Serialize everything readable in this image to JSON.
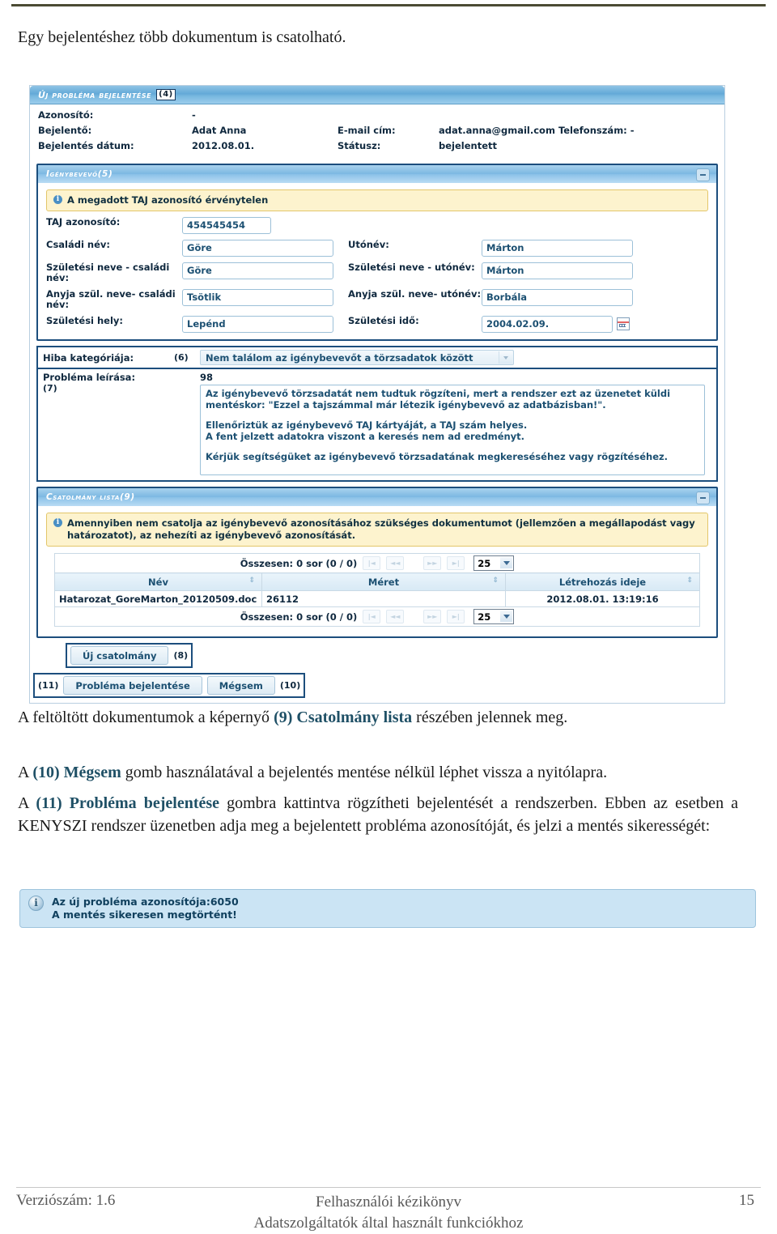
{
  "document": {
    "intro": "Egy bejelentéshez több dokumentum is csatolható.",
    "para_after_1": "A feltöltött dokumentumok a képernyő ",
    "para_after_1_hl": "(9) Csatolmány lista",
    "para_after_1_rest": " részében jelennek meg.",
    "para_after_2_pre": "A ",
    "para_after_2_hl": "(10) Mégsem",
    "para_after_2_rest": " gomb használatával a bejelentés mentése nélkül léphet vissza a nyitólapra.",
    "para_after_3_pre": "A ",
    "para_after_3_hl": "(11) Probléma bejelentése",
    "para_after_3_rest": " gombra kattintva rögzítheti bejelentését a rendszerben. Ebben az esetben a KENYSZI rendszer üzenetben adja meg a bejelentett probléma azonosítóját, és jelzi a mentés sikerességét:"
  },
  "screen": {
    "panel_title": "Új probléma bejelentése",
    "panel_title_tag": "(4)",
    "header_fields": {
      "azonosito_label": "Azonosító:",
      "azonosito_value": "-",
      "bejelento_label": "Bejelentő:",
      "bejelento_value": "Adat Anna",
      "email_label": "E-mail cím:",
      "email_value": "adat.anna@gmail.com Telefonszám:    -",
      "datum_label": "Bejelentés dátum:",
      "datum_value": "2012.08.01.",
      "statusz_label": "Státusz:",
      "statusz_value": "bejelentett"
    },
    "igenybevevo": {
      "section_title": "Igénybevevő",
      "section_tag": "(5)",
      "warning": "A megadott TAJ azonosító érvénytelen",
      "info_icon": "i",
      "fields": [
        {
          "label": "TAJ azonosító:",
          "value": "454545454"
        },
        {
          "label": "Családi név:",
          "value": "Göre"
        },
        {
          "label": "Utónév:",
          "value": "Márton"
        },
        {
          "label": "Születési neve - családi név:",
          "value": "Göre"
        },
        {
          "label": "Születési neve - utónév:",
          "value": "Márton"
        },
        {
          "label": "Anyja szül. neve- családi név:",
          "value": "Tsötlik"
        },
        {
          "label": "Anyja szül. neve- utónév:",
          "value": "Borbála"
        },
        {
          "label": "Születési hely:",
          "value": "Lepénd"
        },
        {
          "label": "Születési idő:",
          "value": "2004.02.09."
        }
      ]
    },
    "category": {
      "label": "Hiba kategóriája:",
      "tag": "(6)",
      "selected": "Nem találom az igénybevevőt a törzsadatok között"
    },
    "description": {
      "label": "Probléma leírása:",
      "tag": "(7)",
      "counter": "98",
      "line1": "Az igénybevevő törzsadatát nem tudtuk rögzíteni, mert a rendszer ezt az üzenetet küldi",
      "line2": "mentéskor: \"Ezzel a tajszámmal már létezik igénybevevő az adatbázisban!\".",
      "line3": "Ellenőriztük az igénybevevő TAJ kártyáját, a TAJ szám helyes.",
      "line4": "A fent jelzett adatokra viszont a keresés nem ad eredményt.",
      "line5": "Kérjük segítségüket az igénybevevő törzsadatának megkereséséhez vagy rögzítéséhez."
    },
    "attachments": {
      "section_title": "Csatolmány lista",
      "section_tag": "(9)",
      "warning_line1": "Amennyiben nem csatolja az igénybevevő azonosításához szükséges dokumentumot (jellemzően a megállapodást",
      "warning_line2": "vagy határozatot), az nehezíti az igénybevevő azonosítását.",
      "paging_summary": "Összesen: 0 sor (0 / 0)",
      "page_size": "25",
      "pager_first": "|◄",
      "pager_prev": "◄◄",
      "pager_next": "►►",
      "pager_last": "►|",
      "columns": [
        "Név",
        "Méret",
        "Létrehozás ideje"
      ],
      "rows": [
        {
          "nev": "Hatarozat_GoreMarton_20120509.doc",
          "meret": "26112",
          "ido": "2012.08.01. 13:19:16"
        }
      ],
      "sort_glyph": "⇕"
    },
    "buttons": {
      "new_attachment": "Új csatolmány",
      "new_attachment_tag": "(8)",
      "submit": "Probléma bejelentése",
      "submit_tag": "(11)",
      "cancel": "Mégsem",
      "cancel_tag": "(10)"
    }
  },
  "success_message": {
    "icon": "i",
    "line1": "Az új probléma azonosítója:6050",
    "line2": "A mentés sikeresen megtörtént!"
  },
  "footer": {
    "version": "Verziószám: 1.6",
    "title_line1": "Felhasználói kézikönyv",
    "title_line2": "Adatszolgáltatók által használt funkciókhoz",
    "page_number": "15"
  },
  "colors": {
    "accent_blue": "#1f5066",
    "panel_blue": "#63a9d8",
    "warning_yellow": "#fdf3ce",
    "success_blue": "#cbe4f4",
    "top_rule": "#4b4b34"
  }
}
